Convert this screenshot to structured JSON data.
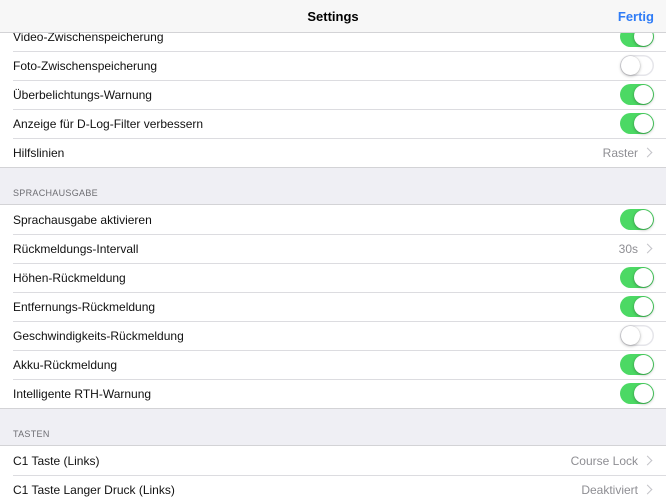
{
  "navbar": {
    "title": "Settings",
    "done_label": "Fertig"
  },
  "camera": {
    "items": [
      {
        "label": "Video-Zwischenspeicherung",
        "type": "toggle",
        "on": true
      },
      {
        "label": "Foto-Zwischenspeicherung",
        "type": "toggle",
        "on": false
      },
      {
        "label": "Überbelichtungs-Warnung",
        "type": "toggle",
        "on": true
      },
      {
        "label": "Anzeige für D-Log-Filter verbessern",
        "type": "toggle",
        "on": true
      },
      {
        "label": "Hilfslinien",
        "type": "value",
        "value": "Raster"
      }
    ]
  },
  "voice": {
    "header": "SPRACHAUSGABE",
    "items": [
      {
        "label": "Sprachausgabe aktivieren",
        "type": "toggle",
        "on": true
      },
      {
        "label": "Rückmeldungs-Intervall",
        "type": "value",
        "value": "30s"
      },
      {
        "label": "Höhen-Rückmeldung",
        "type": "toggle",
        "on": true
      },
      {
        "label": "Entfernungs-Rückmeldung",
        "type": "toggle",
        "on": true
      },
      {
        "label": "Geschwindigkeits-Rückmeldung",
        "type": "toggle",
        "on": false
      },
      {
        "label": "Akku-Rückmeldung",
        "type": "toggle",
        "on": true
      },
      {
        "label": "Intelligente RTH-Warnung",
        "type": "toggle",
        "on": true
      }
    ]
  },
  "buttons": {
    "header": "TASTEN",
    "items": [
      {
        "label": "C1 Taste (Links)",
        "type": "value",
        "value": "Course Lock"
      },
      {
        "label": "C1 Taste Langer Druck (Links)",
        "type": "value",
        "value": "Deaktiviert"
      }
    ]
  },
  "colors": {
    "accent": "#2f7cf6",
    "toggle_on": "#4cd964",
    "background": "#efeff4"
  }
}
